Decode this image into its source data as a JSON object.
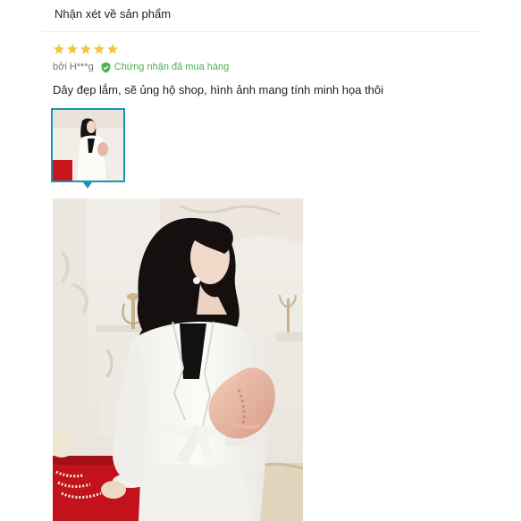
{
  "section": {
    "title": "Nhận xét về sản phẩm"
  },
  "review": {
    "rating": 5,
    "star_icon": "star-icon",
    "star_color": "#f5c542",
    "author": "bởi H***g",
    "verified_icon": "shield-check-icon",
    "verified_label": "Chứng nhận đã mua hàng",
    "verified_color": "#4caf50",
    "comment": "Dây đẹp lắm, sẽ ủng hộ shop, hình ảnh mang tính minh họa thôi"
  },
  "gallery": {
    "accent_color": "#1a94b8",
    "thumbnail_alt": "review photo thumbnail",
    "photo_alt": "woman in white blazer holding pink clutch"
  }
}
